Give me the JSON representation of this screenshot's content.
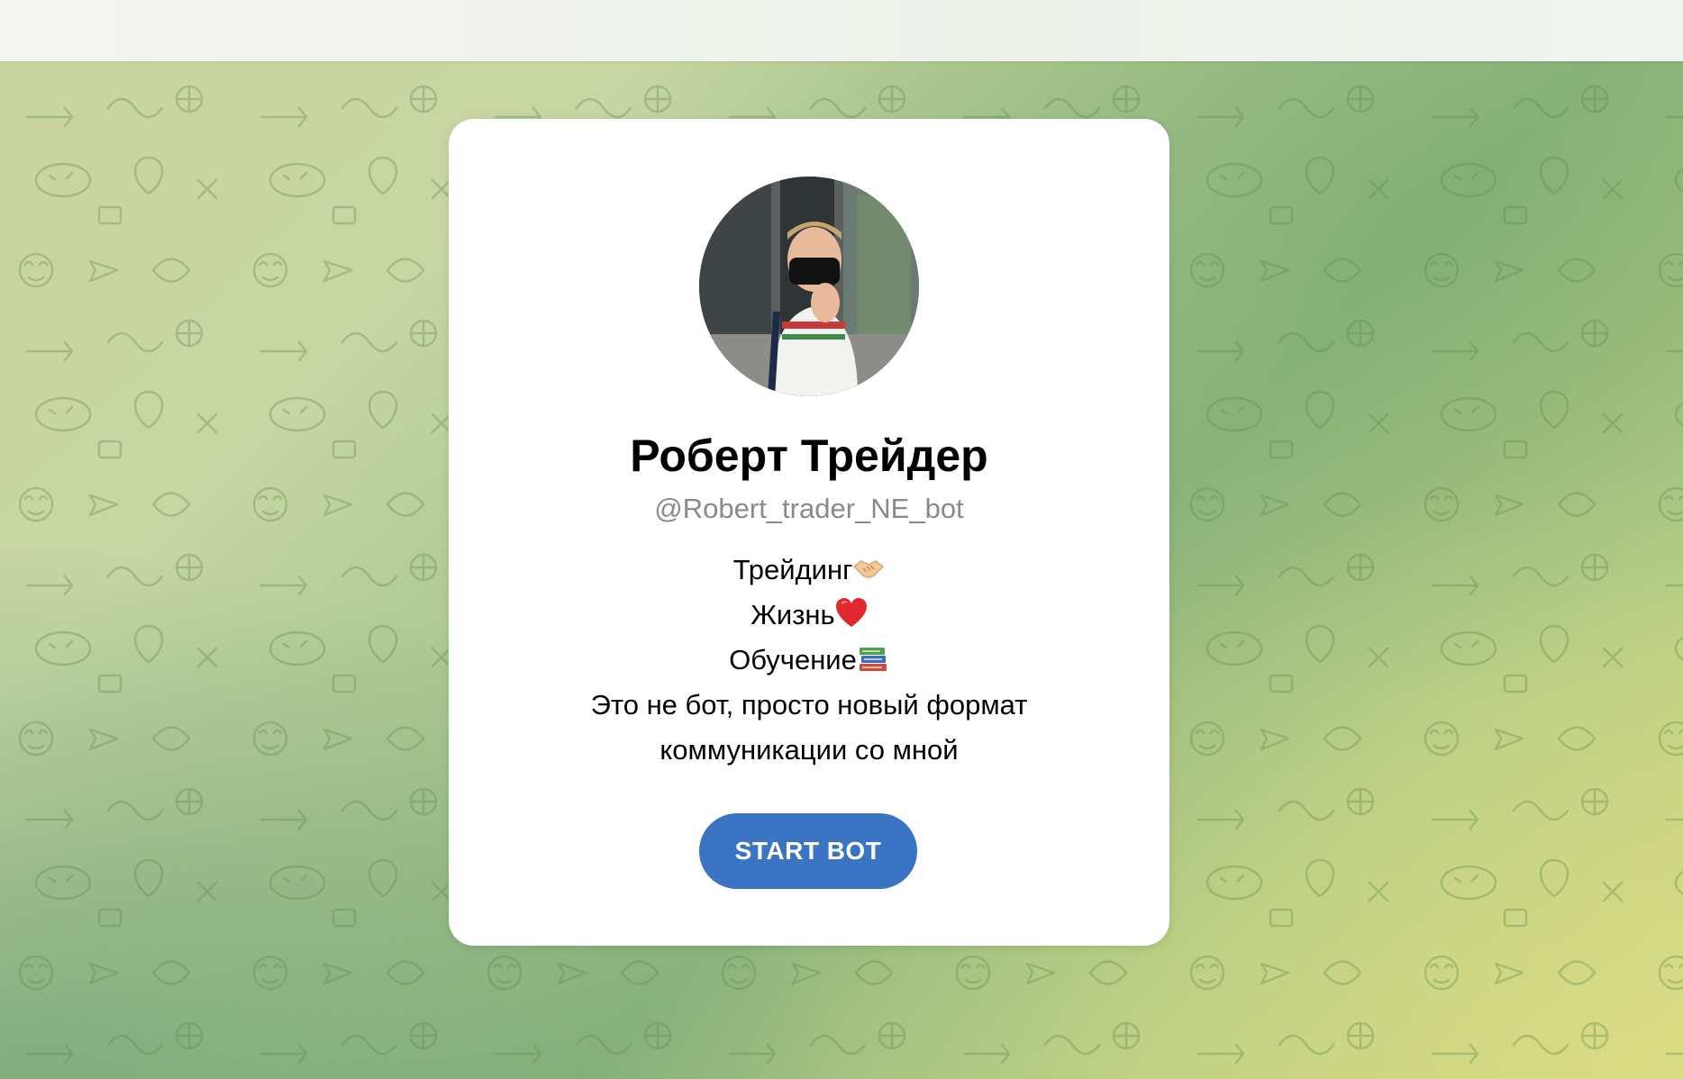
{
  "profile": {
    "name": "Роберт Трейдер",
    "username": "@Robert_trader_NE_bot",
    "description": [
      {
        "text": "Трейдинг",
        "emoji": "handshake-icon"
      },
      {
        "text": "Жизнь",
        "emoji": "heart-icon"
      },
      {
        "text": "Обучение",
        "emoji": "books-icon"
      },
      {
        "text": "Это не бот, просто новый формат",
        "emoji": ""
      },
      {
        "text": "коммуникации со мной",
        "emoji": ""
      }
    ]
  },
  "actions": {
    "start_label": "START BOT"
  },
  "colors": {
    "button": "#3a74c2",
    "username": "#8a8a8a",
    "card": "#ffffff"
  }
}
